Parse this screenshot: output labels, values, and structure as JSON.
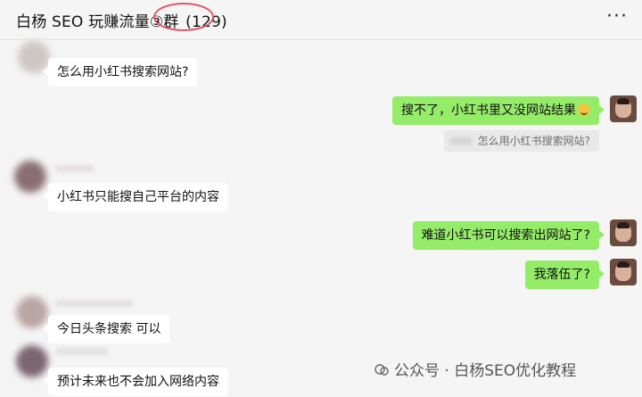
{
  "header": {
    "title": "白杨 SEO 玩赚流量③群",
    "member_count": "(129)",
    "more_glyph": "···"
  },
  "messages": [
    {
      "text": "怎么用小红书搜索网站?"
    },
    {
      "text": "搜不了，小红书里又没网站结果"
    },
    {
      "quote_text": "怎么用小红书搜索网站?"
    },
    {
      "text": "小红书只能搜自己平台的内容"
    },
    {
      "text": "难道小红书可以搜索出网站了?"
    },
    {
      "text": "我落伍了?"
    },
    {
      "text": "今日头条搜索  可以"
    },
    {
      "text": "预计未来也不会加入网络内容"
    }
  ],
  "watermark": {
    "text": "公众号 · 白杨SEO优化教程"
  },
  "colors": {
    "out_bubble": "#95ec69",
    "in_bubble": "#ffffff",
    "background": "#f5f5f5",
    "highlight_circle": "#e0566b"
  }
}
